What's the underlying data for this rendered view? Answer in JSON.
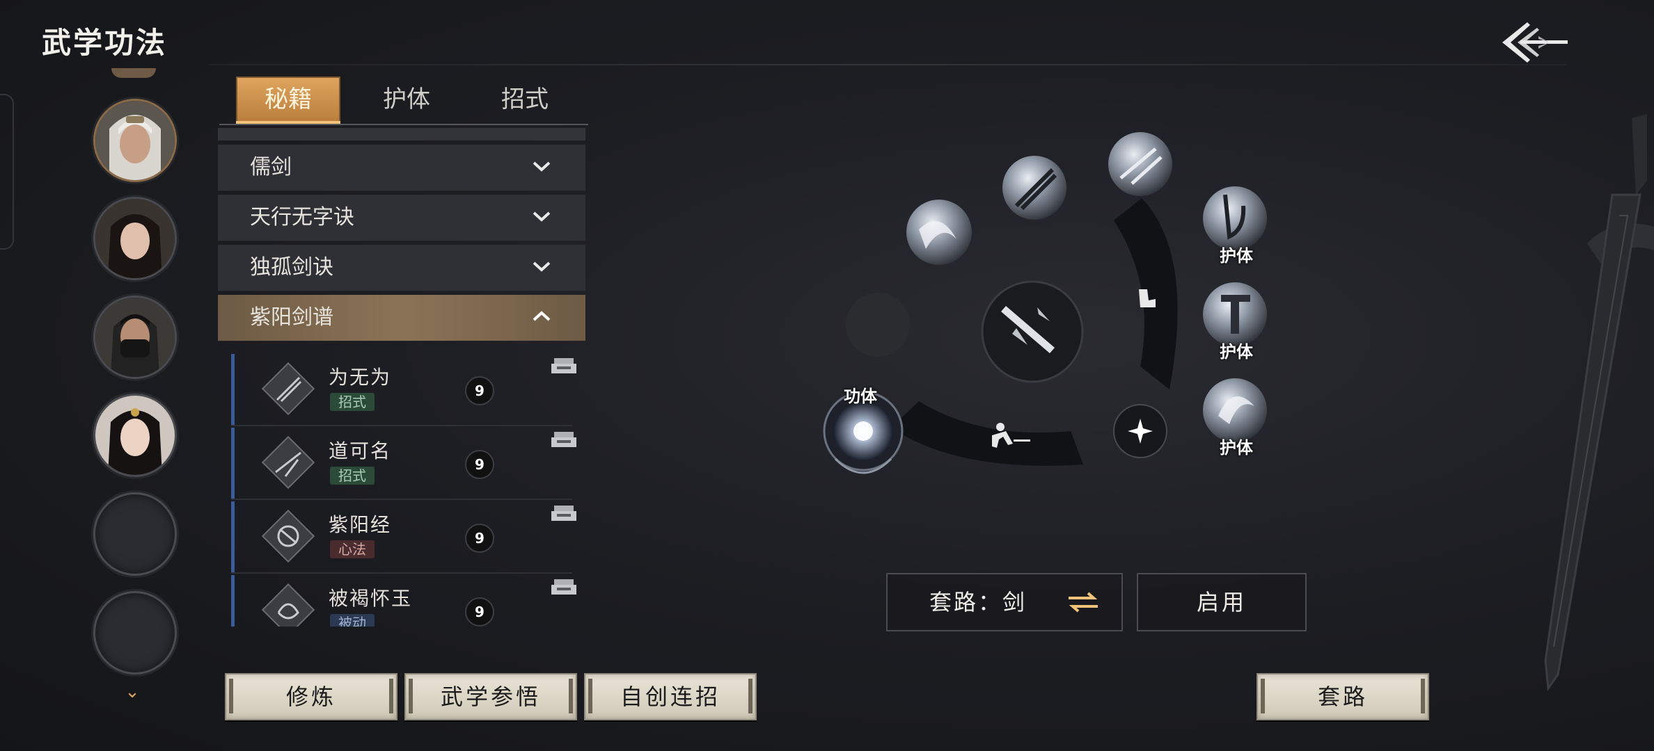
{
  "title": "武学功法",
  "tabs": [
    {
      "label": "秘籍",
      "active": true
    },
    {
      "label": "护体",
      "active": false
    },
    {
      "label": "招式",
      "active": false
    }
  ],
  "categories": [
    {
      "label": "儒剑",
      "expanded": false
    },
    {
      "label": "天行无字诀",
      "expanded": false
    },
    {
      "label": "独孤剑诀",
      "expanded": false
    },
    {
      "label": "紫阳剑谱",
      "expanded": true
    }
  ],
  "skills": [
    {
      "name": "为无为",
      "tag": "招式",
      "tag_type": "zhao",
      "level": "9"
    },
    {
      "name": "道可名",
      "tag": "招式",
      "tag_type": "zhao",
      "level": "9"
    },
    {
      "name": "紫阳经",
      "tag": "心法",
      "tag_type": "xin",
      "level": "9"
    },
    {
      "name": "被褐怀玉",
      "tag": "被动",
      "tag_type": "bei",
      "level": "9"
    }
  ],
  "wheel": {
    "label_gongti": "功体",
    "label_huti_1": "护体",
    "label_huti_2": "护体",
    "label_huti_3": "护体"
  },
  "route": {
    "label": "套路：剑",
    "enable_label": "启用"
  },
  "bottom_buttons": {
    "cultivate": "修炼",
    "comprehend": "武学参悟",
    "custom_combo": "自创连招",
    "routine": "套路"
  },
  "colors": {
    "accent": "#d9a25e",
    "selected_row": "#8b7356",
    "skill_bar": "#3a5c9a"
  }
}
